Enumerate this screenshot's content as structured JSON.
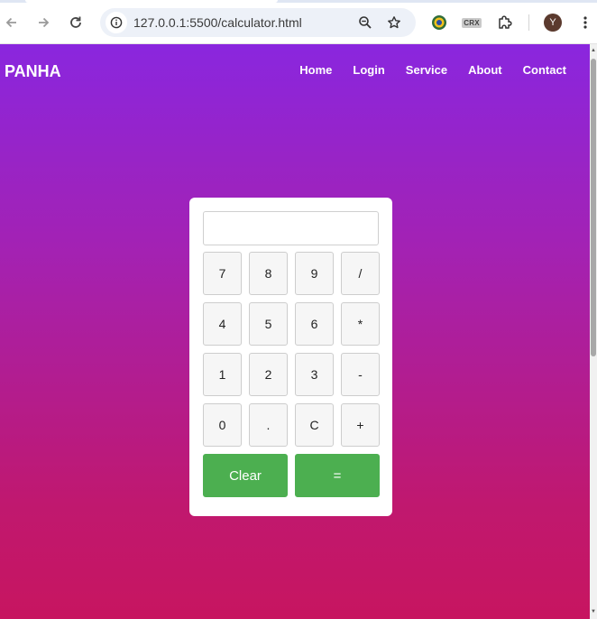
{
  "browser": {
    "url": "127.0.0.1:5500/calculator.html",
    "icons": {
      "back": "back-arrow-icon",
      "forward": "forward-arrow-icon",
      "reload": "reload-icon",
      "site_info": "info-icon",
      "zoom": "zoom-out-icon",
      "bookmark": "star-icon",
      "extension1": "colorful-extension-icon",
      "crx": "CRX",
      "extensions": "puzzle-icon",
      "menu": "three-dot-menu-icon"
    },
    "avatar_letter": "Y"
  },
  "navbar": {
    "brand": "PANHA",
    "links": [
      "Home",
      "Login",
      "Service",
      "About",
      "Contact"
    ]
  },
  "calculator": {
    "display_value": "",
    "keys": [
      "7",
      "8",
      "9",
      "/",
      "4",
      "5",
      "6",
      "*",
      "1",
      "2",
      "3",
      "-",
      "0",
      ".",
      "C",
      "+"
    ],
    "clear_label": "Clear",
    "equals_label": "="
  },
  "colors": {
    "gradient_top": "#8a26de",
    "gradient_bottom": "#c71560",
    "action_green": "#4caf50"
  }
}
